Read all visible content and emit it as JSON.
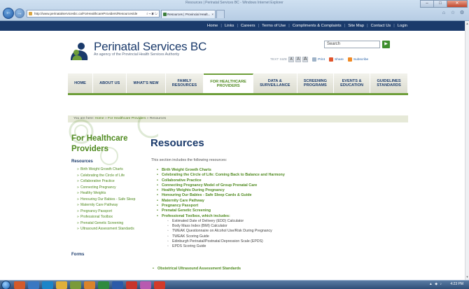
{
  "browser": {
    "window_title": "Resources | Perinatal Services BC - Windows Internet Explorer",
    "address": "http://www.perinatalservicesbc.ca/ForHealthcareProviders/Resources/de",
    "address_icons": "⌕ ▾ ✖ ↻",
    "tab_title": "Resources | Provincial Healt...",
    "tab_close": "×",
    "new_tab": "",
    "controls": {
      "minimize": "–",
      "maximize": "□",
      "close": "✕"
    },
    "toolbar_icons": [
      "home-icon",
      "star-icon",
      "gear-icon"
    ],
    "toolbar_glyphs": [
      "⌂",
      "☆",
      "⚙"
    ]
  },
  "top_links": [
    "Home",
    "Links",
    "Careers",
    "Terms of Use",
    "Compliments & Complaints",
    "Site Map",
    "Contact Us",
    "Login"
  ],
  "top_separator": "|",
  "header": {
    "site_title": "Perinatal Services BC",
    "tagline": "An agency of the Provincial Health Services Authority",
    "search_placeholder": "Search",
    "search_go": "▶",
    "text_size_label": "TEXT SIZE",
    "size_options": [
      "A",
      "A",
      "A"
    ],
    "print_label": "Print",
    "share_label": "Share",
    "subscribe_label": "Subscribe"
  },
  "nav": [
    {
      "label": "HOME",
      "active": false
    },
    {
      "label": "ABOUT US",
      "active": false
    },
    {
      "label": "WHAT'S NEW",
      "active": false
    },
    {
      "label": "FAMILY\nRESOURCES",
      "active": false
    },
    {
      "label": "FOR HEALTHCARE\nPROVIDERS",
      "active": true
    },
    {
      "label": "DATA &\nSURVEILLANCE",
      "active": false
    },
    {
      "label": "SCREENING\nPROGRAMS",
      "active": false
    },
    {
      "label": "EVENTS &\nEDUCATION",
      "active": false
    },
    {
      "label": "GUIDELINES\nSTANDARDS",
      "active": false
    }
  ],
  "breadcrumb": {
    "prefix": "You are here:",
    "items": [
      "Home",
      "For Healthcare Providers",
      "Resources"
    ],
    "separator": "»"
  },
  "sidebar": {
    "title": "For Healthcare\nProviders",
    "section": "Resources",
    "items": [
      "Birth Weight Growth Charts",
      "Celebrating the Circle of Life",
      "Collaborative Practice",
      "Connecting Pregnancy",
      "Healthy Weights",
      "Honouring Our Babies - Safe Sleep",
      "Maternity Care Pathway",
      "Pregnancy Passport",
      "Professional Toolbox",
      "Prenatal Genetic Screening",
      "Ultrasound Assessment Standards"
    ],
    "forms_label": "Forms"
  },
  "main": {
    "title": "Resources",
    "intro": "This section includes the following resources:",
    "resources": [
      "Birth Weight Growth Charts",
      "Celebrating the Circle of Life: Coming Back to Balance and Harmony",
      "Collaborative Practice",
      "Connecting Pregnancy Model of Group Prenatal Care",
      "Healthy Weights During Pregnancy",
      "Honouring Our Babies - Safe Sleep Cards & Guide",
      "Maternity Care Pathway",
      "Pregnancy Passport",
      "Prenatal Genetic Screening",
      "Professional Toolbox, which includes:"
    ],
    "toolbox_items": [
      "Estimated Date of Delivery (EDD) Calculator",
      "Body Mass Index (BMI) Calculator",
      "TWEAK Questionnaire on Alcohol Use/Risk During Pregnancy",
      "TWEAK Scoring Guide",
      "Edinburgh Perinatal/Postnatal Depression Scale (EPDS)",
      "EPDS Scoring Guide"
    ],
    "extra_resource": "Obstetrical Ultrasound Assessment Standards"
  },
  "taskbar": {
    "tray": "▲ ◆ ♪",
    "clock": "4:23 PM"
  },
  "colors": {
    "navy": "#1a3a6b",
    "green": "#4f8a1f",
    "accent_green": "#6e9e3a"
  }
}
